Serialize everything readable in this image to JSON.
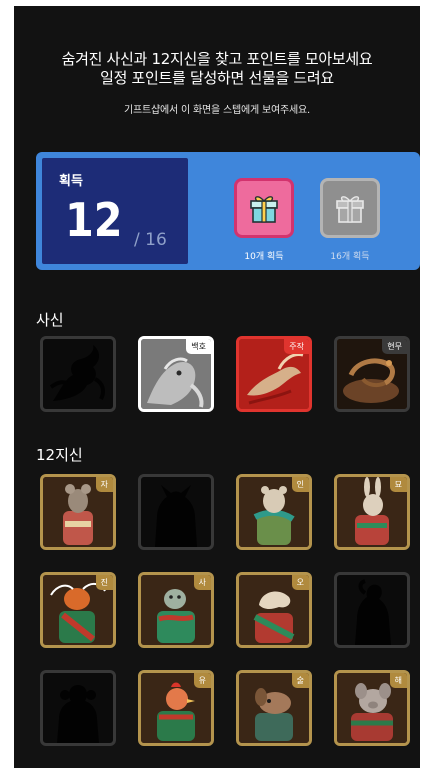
{
  "intro": {
    "line1": "숨겨진 사신과 12지신을 찾고 포인트를 모아보세요",
    "line2": "일정 포인트를 달성하면 선물을 드려요",
    "note": "기프트샵에서 이 화면을 스텝에게 보여주세요."
  },
  "progress": {
    "label": "획득",
    "count": "12",
    "total": "/ 16",
    "rewards": [
      {
        "caption": "10개 획득",
        "achieved": true,
        "icon": "gift-icon"
      },
      {
        "caption": "16개 획득",
        "achieved": false,
        "icon": "gift-icon"
      }
    ]
  },
  "sasin": {
    "title": "사신",
    "items": [
      {
        "tag": "",
        "found": false
      },
      {
        "tag": "백호",
        "found": true
      },
      {
        "tag": "주작",
        "found": true
      },
      {
        "tag": "현무",
        "found": true
      }
    ]
  },
  "zodiac": {
    "title": "12지신",
    "items": [
      {
        "tag": "자",
        "found": true
      },
      {
        "tag": "",
        "found": false
      },
      {
        "tag": "인",
        "found": true
      },
      {
        "tag": "묘",
        "found": true
      },
      {
        "tag": "진",
        "found": true
      },
      {
        "tag": "사",
        "found": true
      },
      {
        "tag": "오",
        "found": true
      },
      {
        "tag": "",
        "found": false
      },
      {
        "tag": "",
        "found": false
      },
      {
        "tag": "유",
        "found": true
      },
      {
        "tag": "술",
        "found": true
      },
      {
        "tag": "해",
        "found": true
      }
    ]
  },
  "colors": {
    "background": "#121212",
    "panel": "#3f86db",
    "count_box": "#1d2c77",
    "reward_active": "#ee6b9d",
    "reward_inactive": "#8f8f8f",
    "zodiac_frame": "#b4944d"
  }
}
